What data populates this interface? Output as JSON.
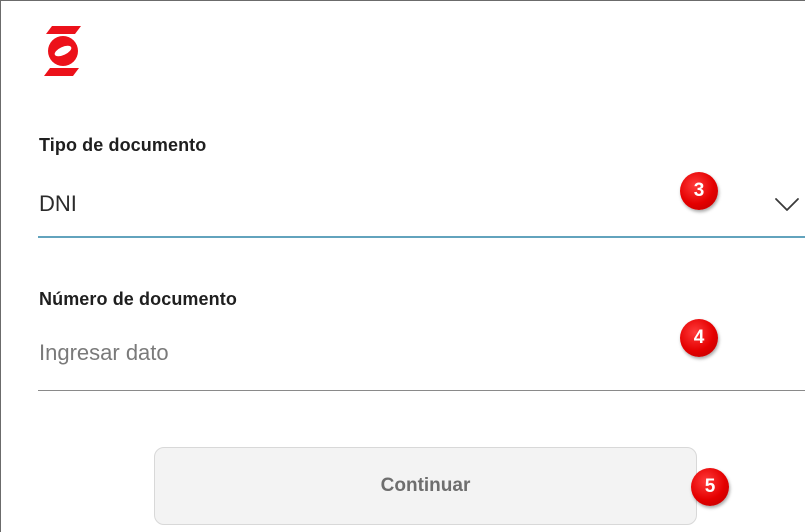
{
  "brand": {
    "logo_icon": "scotiabank-logo-icon",
    "color": "#ec111a"
  },
  "form": {
    "document_type": {
      "label": "Tipo de documento",
      "value": "DNI",
      "chevron_icon": "chevron-down-icon"
    },
    "document_number": {
      "label": "Número de documento",
      "placeholder": "Ingresar dato",
      "value": ""
    },
    "submit": {
      "label": "Continuar",
      "state": "disabled"
    }
  },
  "annotations": {
    "step_3": "3",
    "step_4": "4",
    "step_5": "5",
    "color": "#e40000"
  }
}
